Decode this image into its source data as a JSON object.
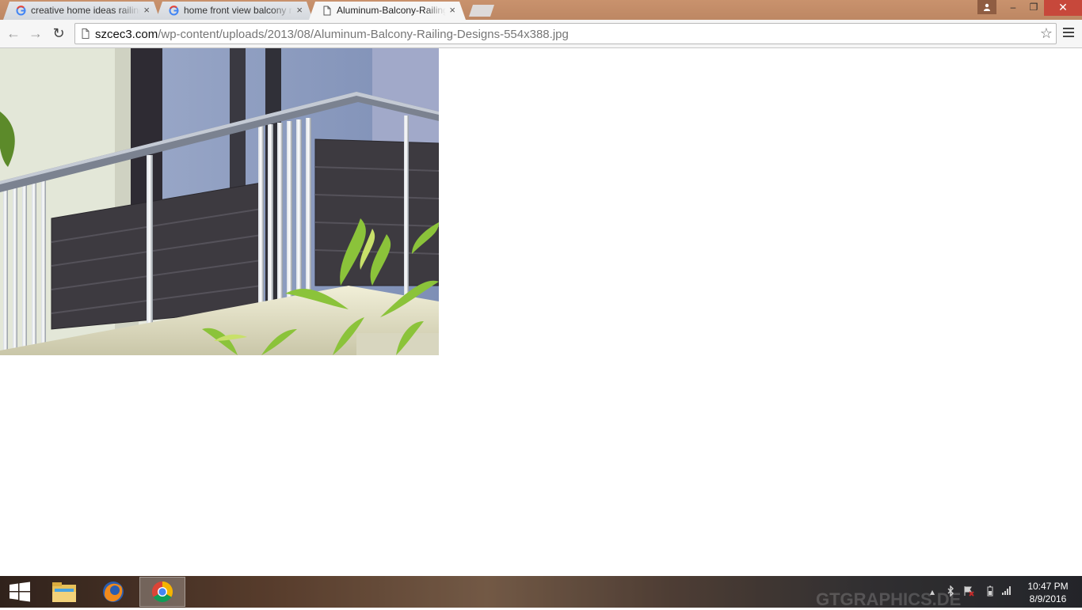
{
  "browser": {
    "tabs": [
      {
        "title": "creative home ideas railing",
        "close": "×",
        "active": false
      },
      {
        "title": "home front view balcony r",
        "close": "×",
        "active": false
      },
      {
        "title": "Aluminum-Balcony-Railing",
        "close": "×",
        "active": true
      }
    ],
    "window_controls": {
      "minimize": "–",
      "restore": "❐",
      "close": "✕"
    },
    "toolbar": {
      "back": "←",
      "forward": "→",
      "reload": "↻",
      "url_host": "szcec3.com",
      "url_path": "/wp-content/uploads/2013/08/Aluminum-Balcony-Railing-Designs-554x388.jpg",
      "star": "☆"
    }
  },
  "content": {
    "image_alt": "Aluminum-Balcony-Railing-Designs-554x388.jpg"
  },
  "taskbar": {
    "watermark": "GTGRAPHICS.DE",
    "clock_time": "10:47 PM",
    "clock_date": "8/9/2016"
  },
  "colors": {
    "tabstrip": "#bd8763",
    "toolbar": "#f6f6f6",
    "close_button": "#c7483b",
    "taskbar": "#4a3a30"
  }
}
